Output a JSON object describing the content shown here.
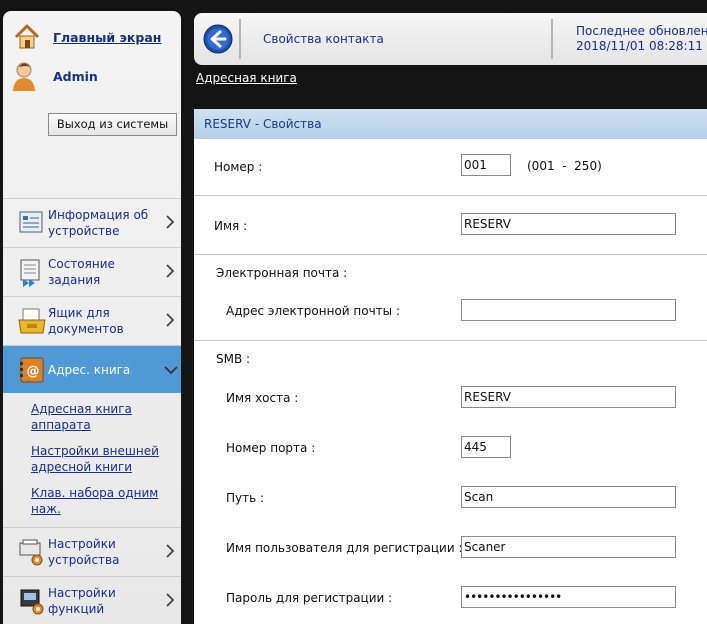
{
  "sidebar": {
    "home_label": "Главный экран",
    "user_label": "Admin",
    "logout_label": "Выход из системы",
    "nav": [
      {
        "label": "Информация об устройстве",
        "icon": "device-info-icon"
      },
      {
        "label": "Состояние задания",
        "icon": "job-status-icon"
      },
      {
        "label": "Ящик для документов",
        "icon": "document-box-icon"
      },
      {
        "label": "Адрес. книга",
        "icon": "address-book-icon"
      },
      {
        "label": "Настройки устройства",
        "icon": "device-settings-icon"
      },
      {
        "label": "Настройки функций",
        "icon": "function-settings-icon"
      }
    ],
    "sub_links": [
      "Адресная книга аппарата",
      "Настройки внешней адресной книги",
      "Клав. набора одним наж."
    ]
  },
  "header": {
    "title": "Свойства контакта",
    "update_label": "Последнее обновление:",
    "update_time": "2018/11/01 08:28:11"
  },
  "breadcrumb": "Адресная книга",
  "panel": {
    "title": "RESERV - Свойства",
    "number_label": "Номер :",
    "number_value": "001",
    "number_range": "(001  -  250)",
    "name_label": "Имя :",
    "name_value": "RESERV",
    "email_section": "Электронная почта :",
    "email_label": "Адрес электронной почты :",
    "email_value": "",
    "smb_section": "SMB :",
    "host_label": "Имя хоста :",
    "host_value": "RESERV",
    "port_label": "Номер порта :",
    "port_value": "445",
    "path_label": "Путь :",
    "path_value": "Scan",
    "user_label": "Имя пользователя для регистрации :",
    "user_value": "Scaner",
    "password_label": "Пароль для регистрации :",
    "password_value": "••••••••••••••••"
  },
  "colors": {
    "accent": "#4f9ad6",
    "link": "#1a2e8c",
    "panel_header": "#b5cfe8"
  }
}
